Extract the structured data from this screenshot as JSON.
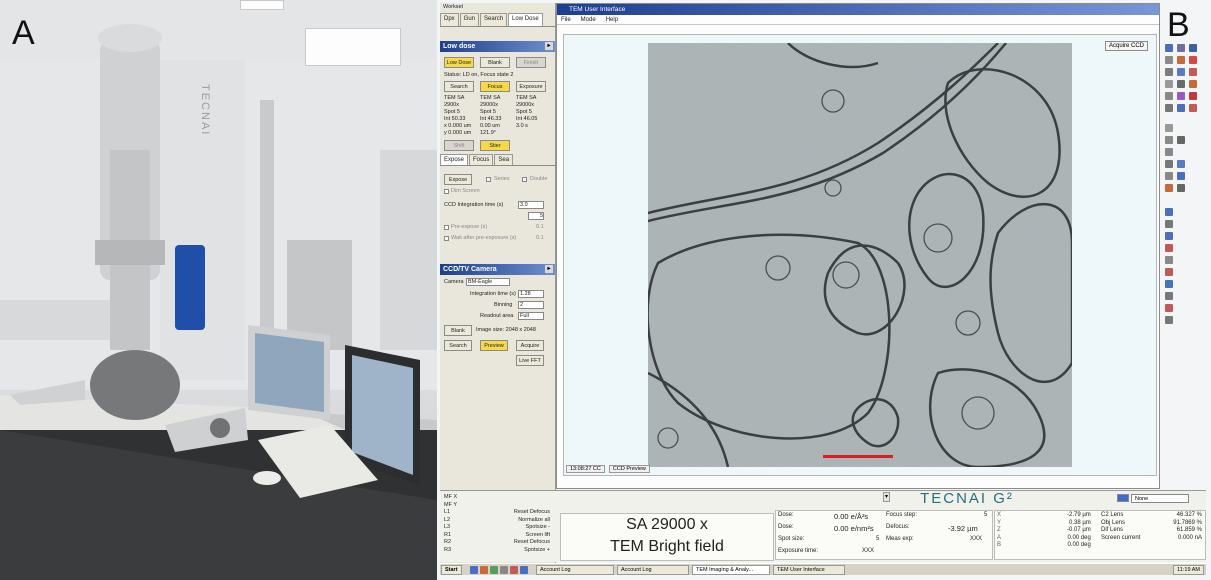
{
  "panel_labels": {
    "a": "A",
    "b": "B"
  },
  "photo": {
    "brand": "TECNAI"
  },
  "left_panel": {
    "window_title": "Workset",
    "tabs": [
      "Dpx",
      "Gun",
      "Search",
      "Low Dose"
    ],
    "low_dose": {
      "header": "Low dose",
      "buttons": {
        "low_dose": "Low Dose",
        "blank": "Blank",
        "finish": "Finish"
      },
      "status": "Status: LD on, Focus state 2",
      "mode_buttons": {
        "search": "Search",
        "focus": "Focus",
        "exposure": "Exposure"
      },
      "columns": [
        {
          "mode": "TEM SA",
          "mag": "2900x",
          "spot": "Spot 5",
          "int": "Int 50.33",
          "x": "x 0.000 um",
          "y": "y 0.000 um",
          "btn": "Shift"
        },
        {
          "mode": "TEM SA",
          "mag": "29000x",
          "spot": "Spot 5",
          "int": "Int 46.33",
          "x": "0.00 um",
          "y": "121.9°",
          "btn": "Stier"
        },
        {
          "mode": "TEM SA",
          "mag": "29000x",
          "spot": "Spot 5",
          "int": "Int 46.05",
          "x": "3.0 s",
          "y": "",
          "btn": ""
        }
      ]
    },
    "expose": {
      "tabs": [
        "Expose",
        "Focus",
        "Sea"
      ],
      "expose_button": "Expose",
      "series": "Series",
      "double": "Double",
      "dim_screen": "Dim Screen",
      "ccd_label": "CCD Integration time (s)",
      "ccd_value": "3.0",
      "count_value": "5",
      "pre_expose": "Pre-expose (s)",
      "pre_expose_value": "0.1",
      "wait": "Wait after pre-exposure (s)",
      "wait_value": "0.1"
    },
    "ccd_camera": {
      "header": "CCD/TV Camera",
      "camera_label": "Camera",
      "camera_value": "BM-Eagle",
      "integration_label": "Integration time (s)",
      "integration_value": "1.28",
      "binning_label": "Binning",
      "binning_value": "2",
      "readout_label": "Readout area",
      "readout_value": "Full",
      "image_size": "Image size: 2048 x 2048",
      "buttons": {
        "blank": "Blank",
        "search": "Search",
        "preview": "Preview",
        "acquire": "Acquire",
        "live_fft": "Live FFT"
      }
    }
  },
  "main_window": {
    "title": "TEM User Interface",
    "menu": [
      "File",
      "Mode",
      "Help"
    ],
    "acquire_ccd": "Acquire CCD",
    "status_time": "13:08:27 CC",
    "status_preview": "CCD Preview"
  },
  "bottom": {
    "controls": [
      {
        "key": "MF X",
        "val": ""
      },
      {
        "key": "MF Y",
        "val": ""
      },
      {
        "key": "L1",
        "val": "Reset Defocus"
      },
      {
        "key": "L2",
        "val": "Normalize all"
      },
      {
        "key": "L3",
        "val": "Spotsize -"
      },
      {
        "key": "R1",
        "val": "Screen lift"
      },
      {
        "key": "R2",
        "val": "Reset Defocus"
      },
      {
        "key": "R3",
        "val": "Spotsize +"
      }
    ],
    "big_line1": "SA 29000 x",
    "big_line2": "TEM Bright field",
    "dose": [
      {
        "label": "Dose:",
        "value": "0.00 e/Å²s"
      },
      {
        "label": "Dose:",
        "value": "0.00 e/nm²s"
      },
      {
        "label": "Spot size:",
        "value": "5"
      },
      {
        "label": "Exposure time:",
        "value": "XXX"
      }
    ],
    "focus": [
      {
        "label": "Focus step:",
        "value": "5"
      },
      {
        "label": "Defocus:",
        "value": "-3.92 µm"
      },
      {
        "label": "Meas exp:",
        "value": "XXX"
      }
    ],
    "stage": [
      {
        "axis": "X",
        "value": "-2.79 µm"
      },
      {
        "axis": "Y",
        "value": "0.38 µm"
      },
      {
        "axis": "Z",
        "value": "-0.07 µm"
      },
      {
        "axis": "A",
        "value": "0.00 deg"
      },
      {
        "axis": "B",
        "value": "0.00 deg"
      }
    ],
    "lens": [
      {
        "label": "C2 Lens",
        "value": "46.327 %"
      },
      {
        "label": "Obj Lens",
        "value": "91.7869 %"
      },
      {
        "label": "Dif Lens",
        "value": "61.859 %"
      },
      {
        "label": "Screen current",
        "value": "0.000 nA"
      }
    ],
    "brand": "TECNAI G²",
    "none_select": "None"
  },
  "taskbar": {
    "start": "Start",
    "items": [
      "Account Log",
      "Account Log",
      "TEM Imaging & Analy...",
      "TEM User Interface"
    ],
    "clock": "11:19 AM"
  }
}
